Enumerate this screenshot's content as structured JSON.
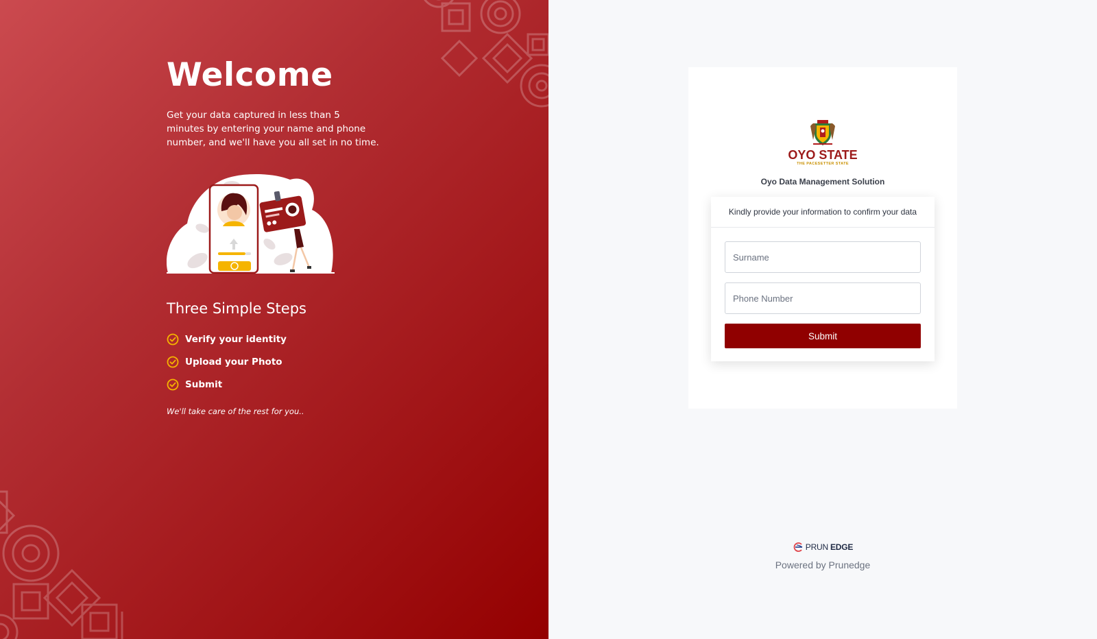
{
  "hero": {
    "title": "Welcome",
    "intro": "Get your data captured in less than 5 minutes by entering your name and phone number, and we'll have you all set in no time.",
    "steps_title": "Three Simple Steps",
    "steps": [
      {
        "label": "Verify your identity",
        "icon": "check-circle-icon"
      },
      {
        "label": "Upload your Photo",
        "icon": "check-circle-icon"
      },
      {
        "label": "Submit",
        "icon": "check-circle-icon"
      }
    ],
    "outro": "We'll take care of the rest for you.."
  },
  "logo": {
    "state_name": "OYO STATE",
    "motto": "THE PACESETTER STATE"
  },
  "app_name": "Oyo Data Management Solution",
  "form": {
    "instruction": "Kindly provide your information to confirm your data",
    "surname": {
      "placeholder": "Surname",
      "value": ""
    },
    "phone": {
      "placeholder": "Phone Number",
      "value": ""
    },
    "submit_label": "Submit"
  },
  "footer": {
    "brand_part1": "PRUN",
    "brand_part2": "EDGE",
    "powered_by": "Powered by Prunedge"
  },
  "colors": {
    "brand_red": "#900000",
    "accent_gold": "#f5b400",
    "page_bg": "#f7f8fa"
  }
}
